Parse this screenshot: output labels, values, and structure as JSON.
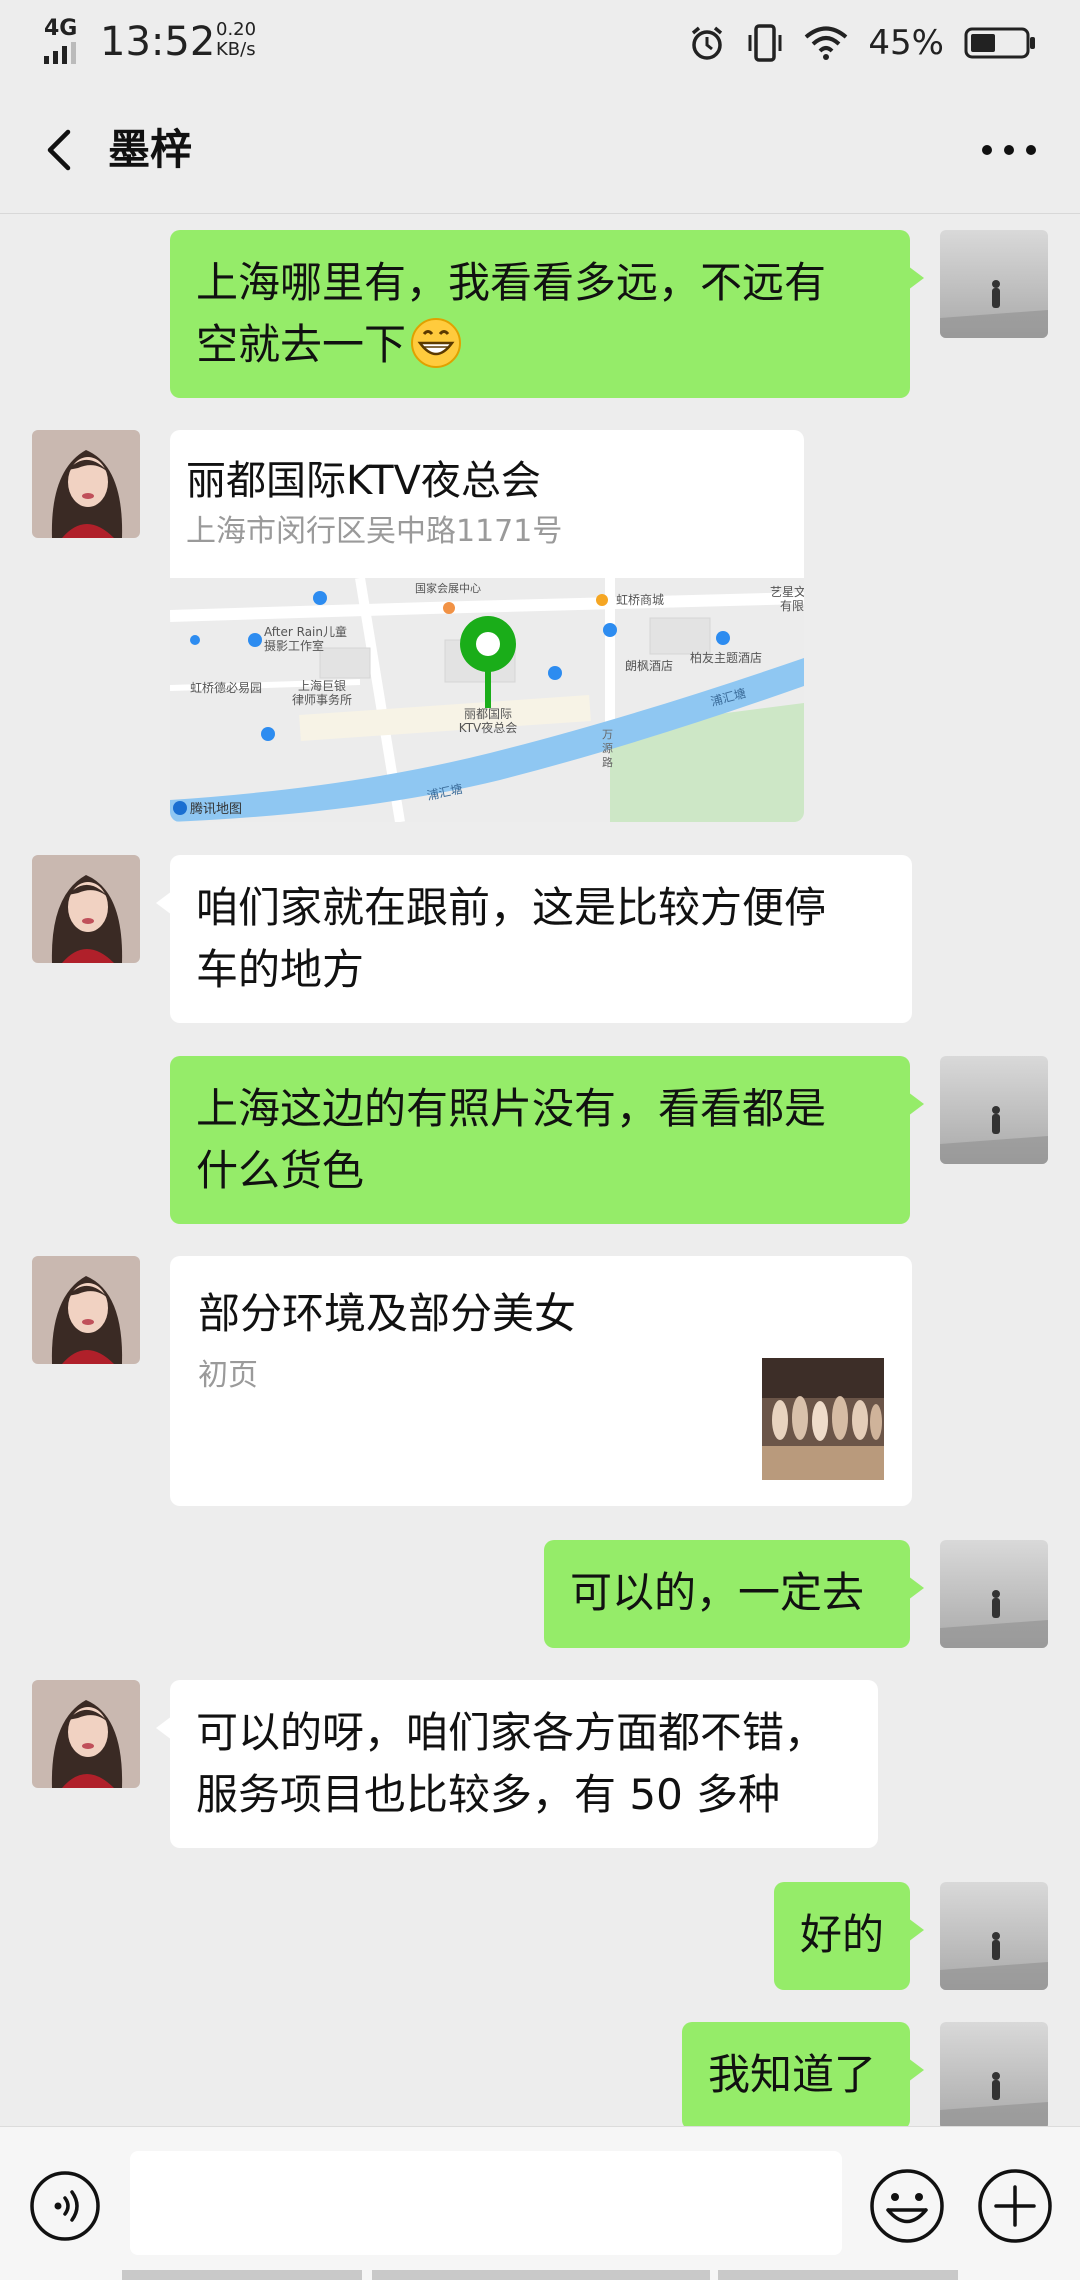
{
  "status_bar": {
    "network": "4G",
    "time": "13:52",
    "speed_value": "0.20",
    "speed_unit": "KB/s",
    "battery": "45%",
    "icons": [
      "alarm-icon",
      "vibrate-icon",
      "wifi-icon",
      "battery-icon"
    ]
  },
  "header": {
    "title": "墨梓",
    "back_icon": "chevron-left-icon",
    "more_icon": "more-dots-icon"
  },
  "messages": [
    {
      "side": "self",
      "text": "上海哪里有，我看看多远，不远有",
      "text2": "空就去一下",
      "emoji": "grinning-face"
    },
    {
      "side": "other",
      "type": "location",
      "name": "丽都国际KTV夜总会",
      "address": "上海市闵行区吴中路1171号",
      "map_labels": {
        "center": "丽都国际\nKTV夜总会",
        "place1": "国家会展中心",
        "place2": "虹桥商城",
        "place3": "After Rain儿童摄影工作室",
        "place4": "虹桥德必易园",
        "place5": "上海巨银律师事务所",
        "place6": "朗枫酒店",
        "place7": "柏友主题酒店",
        "place8": "艺星文有限",
        "river1": "浦汇塘",
        "river2": "浦汇塘",
        "road": "万源路",
        "provider": "腾讯地图"
      }
    },
    {
      "side": "other",
      "text": "咱们家就在跟前，这是比较方便停",
      "text2": "车的地方"
    },
    {
      "side": "self",
      "text": "上海这边的有照片没有，看看都是",
      "text2": "什么货色"
    },
    {
      "side": "other",
      "type": "link",
      "title": "部分环境及部分美女",
      "desc": "初页"
    },
    {
      "side": "self",
      "text": "可以的，一定去"
    },
    {
      "side": "other",
      "text": "可以的呀，咱们家各方面都不错，",
      "text2": "服务项目也比较多，有 50 多种"
    },
    {
      "side": "self",
      "text": "好的"
    },
    {
      "side": "self",
      "text": "我知道了"
    }
  ],
  "input_bar": {
    "placeholder": "",
    "voice_icon": "voice-icon",
    "emoji_icon": "emoji-icon",
    "plus_icon": "plus-icon"
  },
  "colors": {
    "self_bubble": "#95ec69",
    "other_bubble": "#ffffff",
    "background": "#ededed",
    "map_pin": "#1aad19"
  }
}
